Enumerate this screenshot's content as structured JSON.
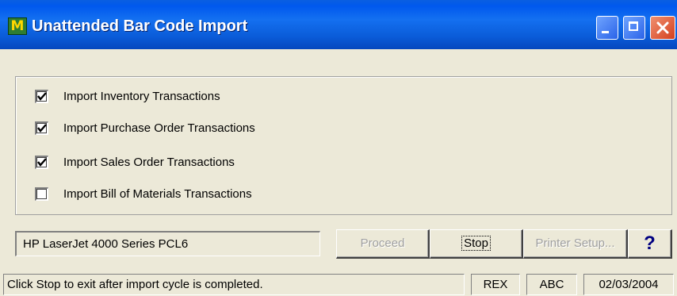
{
  "window": {
    "title": "Unattended Bar Code Import",
    "app_icon_letter": "M",
    "icon": "app-module-icon"
  },
  "options": [
    {
      "label": "Import Inventory Transactions",
      "checked": true
    },
    {
      "label": "Import Purchase Order Transactions",
      "checked": true
    },
    {
      "label": "Import Sales Order Transactions",
      "checked": true
    },
    {
      "label": "Import Bill of Materials Transactions",
      "checked": false
    }
  ],
  "printer": {
    "value": "HP LaserJet 4000 Series PCL6"
  },
  "buttons": {
    "proceed": "Proceed",
    "stop": "Stop",
    "printer_setup": "Printer Setup...",
    "help": "?"
  },
  "status": {
    "message": "Click Stop to exit after import cycle is completed.",
    "user": "REX",
    "company": "ABC",
    "date": "02/03/2004"
  },
  "colors": {
    "titlebar": "#0A5FE0",
    "window_bg": "#ECE9D8",
    "close_button": "#D4401E"
  }
}
